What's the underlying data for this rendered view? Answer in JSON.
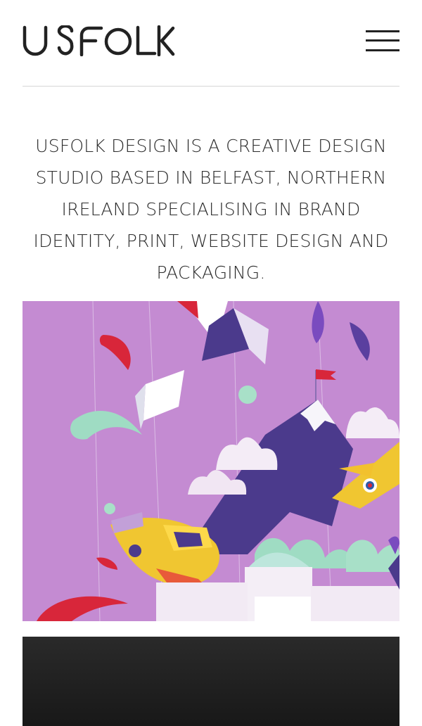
{
  "brand": {
    "logo_text": "USFOLK"
  },
  "header": {
    "menu_icon": "hamburger-menu-icon"
  },
  "intro": {
    "text": "USFOLK DESIGN IS A CREATIVE DESIGN STUDIO BASED IN BELFAST, NORTHERN IRELAND SPECIALISING IN BRAND IDENTITY, PRINT, WEBSITE DESIGN AND PACKAGING."
  },
  "projects": [
    {
      "image": "paper-craft-illustration",
      "palette": {
        "background": "#c48bd2",
        "mountain": "#4b3a8c",
        "accent_red": "#d8263a",
        "accent_yellow": "#f0c631",
        "accent_mint": "#9fdcc3"
      }
    },
    {
      "image": "dark-project-thumbnail",
      "palette": {
        "background": "#1c1c1c"
      }
    }
  ],
  "colors": {
    "text": "#222222",
    "divider": "#d6d6d6",
    "page_background": "#ffffff"
  }
}
